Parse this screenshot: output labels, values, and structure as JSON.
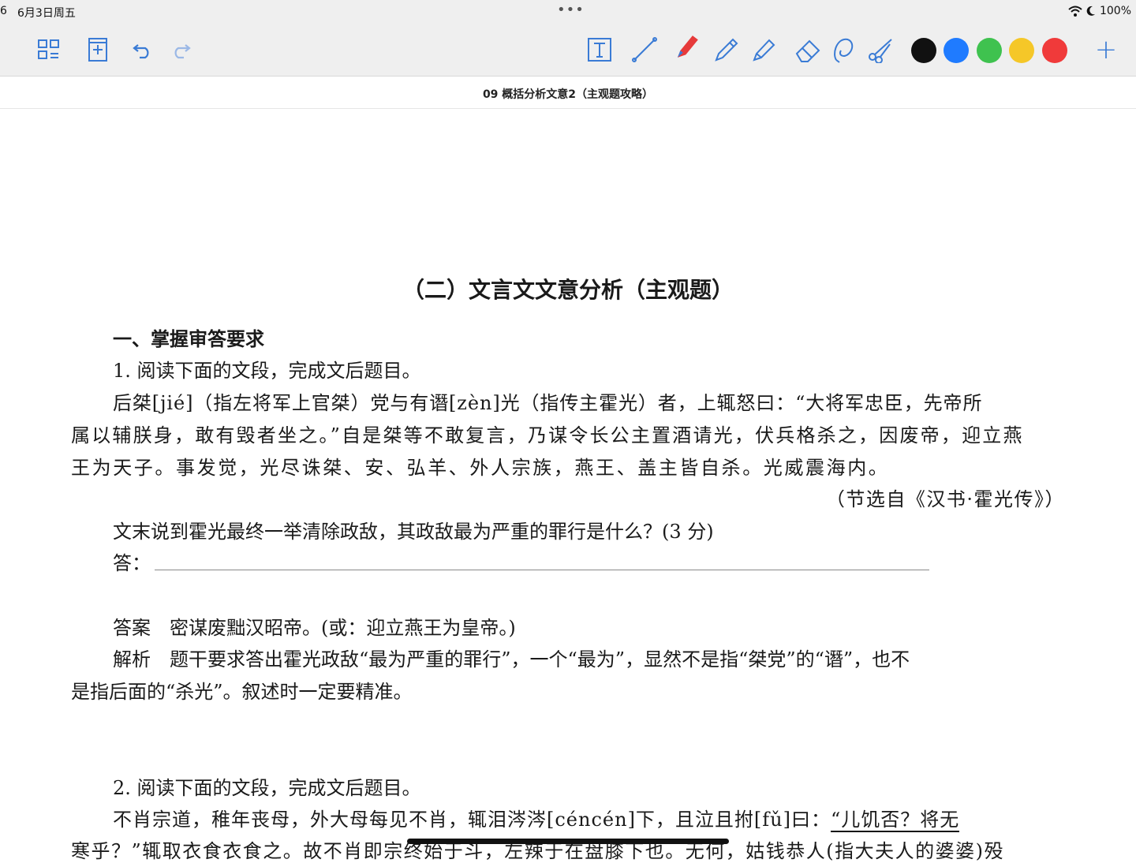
{
  "status_bar": {
    "time": "6",
    "date": "6月3日周五",
    "dots": "•••",
    "battery": "100%"
  },
  "toolbar": {
    "left_icons": [
      "grid-icon",
      "add-page-icon",
      "undo-icon",
      "redo-icon"
    ],
    "tool_icons": [
      "text-tool-icon",
      "line-tool-icon",
      "marker-icon",
      "pencil-icon",
      "highlighter-icon",
      "eraser-icon",
      "lasso-icon",
      "scissors-icon"
    ],
    "colors": [
      "#111111",
      "#1f7bff",
      "#3fc24f",
      "#f5c728",
      "#f03a3a"
    ],
    "plus_icon": "+"
  },
  "document": {
    "title": "09 概括分析文意2（主观题攻略）"
  },
  "content": {
    "heading": "（二）文言文文意分析（主观题）",
    "section1": "一、掌握审答要求",
    "q1_intro": "1. 阅读下面的文段，完成文后题目。",
    "q1_p1": "后桀[jié]（指左将军上官桀）党与有谮[zèn]光（指传主霍光）者，上辄怒曰：“大将军忠臣，先帝所",
    "q1_p2": "属以辅朕身，敢有毁者坐之。”自是桀等不敢复言，乃谋令长公主置酒请光，伏兵格杀之，因废帝，迎立燕",
    "q1_p3": "王为天子。事发觉，光尽诛桀、安、弘羊、外人宗族，燕王、盖主皆自杀。光威震海内。",
    "q1_source": "（节选自《汉书·霍光传》）",
    "q1_question": "文末说到霍光最终一举清除政敌，其政敌最为严重的罪行是什么？(3 分)",
    "q1_answer_label": "答：",
    "q1_answer": "答案　密谋废黜汉昭帝。(或：迎立燕王为皇帝。)",
    "q1_analysis_1": "解析　题干要求答出霍光政敌“最为严重的罪行”，一个“最为”，显然不是指“桀党”的“谮”，也不",
    "q1_analysis_2": "是指后面的“杀光”。叙述时一定要精准。",
    "q2_intro": "2. 阅读下面的文段，完成文后题目。",
    "q2_p1": "不肖宗道，稚年丧母，外大母每见不肖，辄泪涔涔[céncén]下，且泣且拊[fǔ]曰：",
    "q2_p1_underlined": "“儿饥否？将无",
    "q2_p2": "寒乎？”辄取衣食衣食之。故不肖即宗终始于斗，左辣于在盘膝下也。无何，姑钱恭人(指大夫人的婆婆)殁"
  }
}
